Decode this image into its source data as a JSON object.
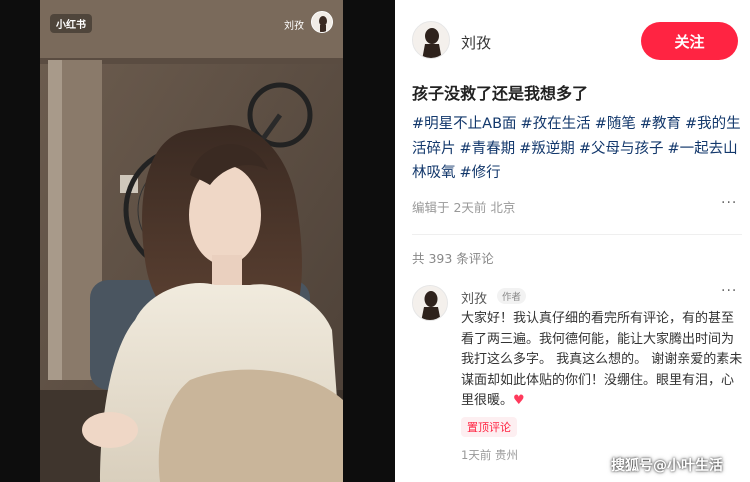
{
  "video": {
    "watermark_logo": "小红书",
    "watermark_user": "刘孜"
  },
  "author": {
    "name": "刘孜",
    "follow_label": "关注"
  },
  "post": {
    "title": "孩子没救了还是我想多了",
    "tags": [
      "#明星不止AB面",
      "#孜在生活",
      "#随笔",
      "#教育",
      "#我的生活碎片",
      "#青春期",
      "#叛逆期",
      "#父母与孩子",
      "#一起去山林吸氧",
      "#修行"
    ],
    "meta": "编辑于 2天前 北京",
    "more": "···"
  },
  "comments": {
    "count_label": "共 393 条评论",
    "items": [
      {
        "name": "刘孜",
        "badge": "作者",
        "text": "大家好！我认真仔细的看完所有评论，有的甚至看了两三遍。我何德何能，能让大家腾出时间为我打这么多字。 我真这么想的。 谢谢亲爱的素未谋面却如此体贴的你们！没绷住。眼里有泪，心里很暖。",
        "heart": "♥",
        "pin_label": "置顶评论",
        "meta": "1天前 贵州",
        "more": "···"
      }
    ]
  },
  "watermark": "搜狐号@小叶生活",
  "colors": {
    "accent": "#ff2442",
    "tag": "#13386c"
  },
  "icons": {
    "heart": "heart-icon",
    "more": "more-icon"
  }
}
